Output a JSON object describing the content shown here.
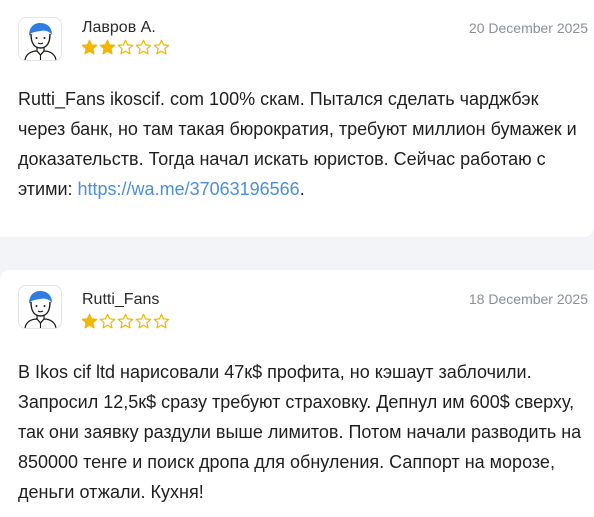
{
  "reviews": [
    {
      "author": "Лавров А.",
      "date": "20 December 2025",
      "rating": 2,
      "max_rating": 5,
      "text_before": "Rutti_Fans ikoscif. com 100% скам. Пытался сделать чарджбэк через банк, но там такая бюрократия, требуют миллион бумажек и доказательств. Тогда начал искать юристов. Сейчас работаю с этими: ",
      "link": "https://wa.me/37063196566",
      "text_after": "."
    },
    {
      "author": "Rutti_Fans",
      "date": "18 December 2025",
      "rating": 1,
      "max_rating": 5,
      "text_before": "В Ikos cif ltd нарисовали 47к$ профита, но кэшаут заблочили. Запросил 12,5к$ сразу требуют страховку. Депнул им 600$ сверху, так они заявку раздули выше лимитов. Потом начали разводить на 850000 тенге и поиск дропа для обнуления. Саппорт на морозе, деньги отжали. Кухня!",
      "link": "",
      "text_after": ""
    }
  ],
  "colors": {
    "star_filled": "#f2b705",
    "star_empty_stroke": "#f2b705",
    "link": "#4a8fd8",
    "avatar_hair": "#2f7de1"
  },
  "icons": {
    "avatar": "user-avatar-icon",
    "star_filled": "star-filled-icon",
    "star_empty": "star-empty-icon"
  }
}
